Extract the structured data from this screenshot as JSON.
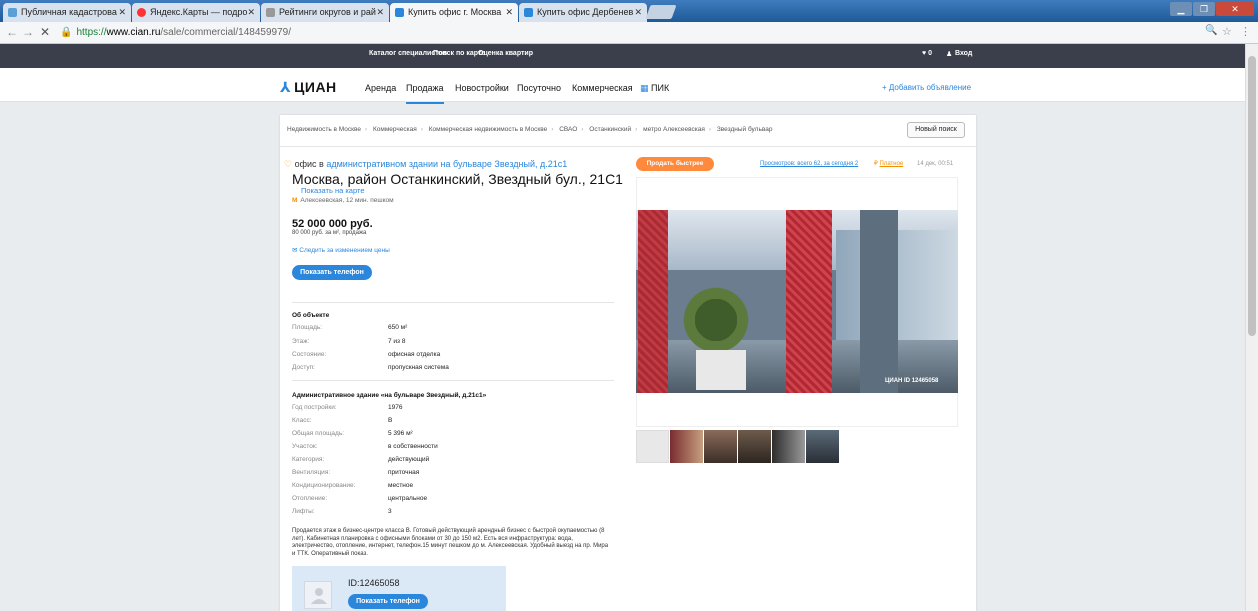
{
  "browser": {
    "tabs": [
      {
        "label": "Публичная кадастрова",
        "color": "#5aa0d8"
      },
      {
        "label": "Яндекс.Карты — подро",
        "color": "#ff3333"
      },
      {
        "label": "Рейтинги округов и рай",
        "color": "#777777"
      },
      {
        "label": "Купить офис г. Москва",
        "color": "#2b87db"
      },
      {
        "label": "Купить офис Дербенев",
        "color": "#2b87db"
      }
    ],
    "url_scheme": "https://",
    "url_host": "www.cian.ru",
    "url_path": "/sale/commercial/148459979/"
  },
  "topbar": {
    "links": [
      "Каталог специалистов",
      "Поиск по карте",
      "Оценка квартир"
    ],
    "favorites": "♥ 0",
    "login": "Вход"
  },
  "header": {
    "logo": "ЦИАН",
    "nav": [
      "Аренда",
      "Продажа",
      "Новостройки",
      "Посуточно",
      "Коммерческая",
      "ПИК"
    ],
    "add_ad": "+ Добавить объявление"
  },
  "breadcrumbs": [
    "Недвижимость в Москве",
    "Коммерческая",
    "Коммерческая недвижимость в Москве",
    "СВАО",
    "Останкинский",
    "метро Алексеевская",
    "Звездный бульвар"
  ],
  "new_search": "Новый поиск",
  "listing": {
    "type_prefix": "офис в",
    "type_link": "административном здании на бульваре Звездный, д.21с1",
    "address": "Москва, район Останкинский, Звездный бул., 21С1",
    "show_map": "Показать на карте",
    "metro": "Алексеевская, 12 мин. пешком",
    "metro_icon": "М",
    "price": "52 000 000 руб.",
    "price_per_m": "80 000 руб. за м², продажа",
    "watch_price": "Следить за изменением цены",
    "show_phone": "Показать телефон"
  },
  "about": {
    "title": "Об объекте",
    "rows": [
      {
        "label": "Площадь:",
        "value": "650 м²"
      },
      {
        "label": "Этаж:",
        "value": "7 из 8"
      },
      {
        "label": "Состояние:",
        "value": "офисная отделка"
      },
      {
        "label": "Доступ:",
        "value": "пропускная система"
      }
    ]
  },
  "building": {
    "title": "Административное здание «на бульваре Звездный, д.21с1»",
    "rows": [
      {
        "label": "Год постройки:",
        "value": "1976"
      },
      {
        "label": "Класс:",
        "value": "B"
      },
      {
        "label": "Общая площадь:",
        "value": "5 396 м²"
      },
      {
        "label": "Участок:",
        "value": "в собственности"
      },
      {
        "label": "Категория:",
        "value": "действующий"
      },
      {
        "label": "Вентиляция:",
        "value": "приточная"
      },
      {
        "label": "Кондиционирование:",
        "value": "местное"
      },
      {
        "label": "Отопление:",
        "value": "центральное"
      },
      {
        "label": "Лифты:",
        "value": "3"
      }
    ]
  },
  "description": "Продается этаж в бизнес-центре класса В. Готовый действующий арендный бизнес с быстрой окупаемостью (8 лет). Кабинетная планировка с офисными блоками от 30 до 150 м2. Есть вся инфраструктура: вода, электричество, отопление, интернет, телефон.15 минут пешком до м. Алексеевская. Удобный выезд на пр. Мира и ТТК. Оперативный показ.",
  "agent": {
    "id": "ID:12465058",
    "show_phone": "Показать телефон"
  },
  "gallery": {
    "sell_fast": "Продать быстрее",
    "views": "Просмотров: всего 62, за сегодня 2",
    "paid": "Платное",
    "paid_icon": "₽",
    "date": "14 дек, 00:51",
    "watermark": "ЦИАН ID 12465058",
    "thumb_colors": [
      "#e8e8e8",
      "#7a2b30",
      "#8b6b5a",
      "#6e5b4c",
      "#2d2d2d",
      "#5b6a78"
    ]
  }
}
